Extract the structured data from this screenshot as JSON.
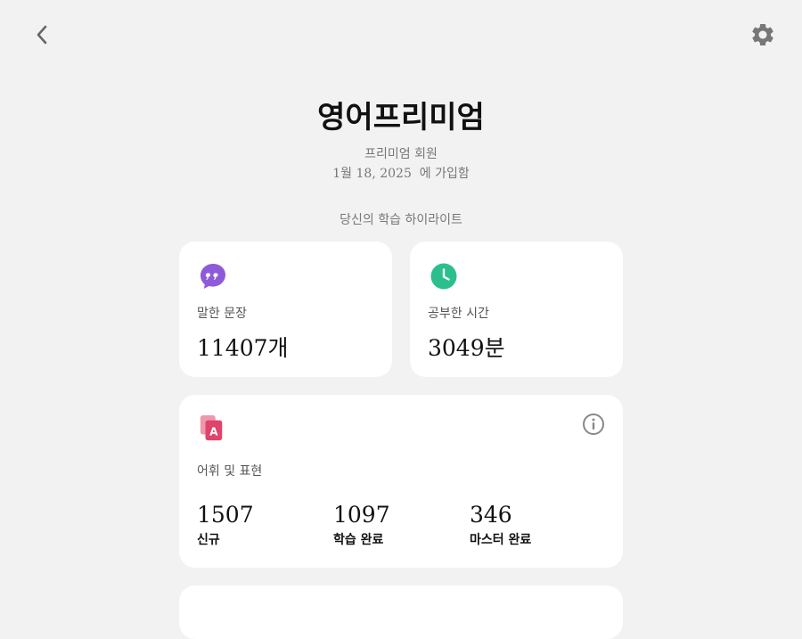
{
  "header": {
    "title": "영어프리미엄",
    "membership": "프리미엄 회원",
    "joined": "1월 18, 2025  에 가입함"
  },
  "highlights": {
    "label": "당신의 학습 하이라이트"
  },
  "stats": {
    "sentences": {
      "label": "말한 문장",
      "value": "11407개",
      "icon": "speech-bubble-quote-icon",
      "color": "#8e5bd8"
    },
    "time": {
      "label": "공부한 시간",
      "value": "3049분",
      "icon": "clock-icon",
      "color": "#2cbf8e"
    }
  },
  "vocab": {
    "label": "어휘 및 표현",
    "icon": "vocab-cards-icon",
    "color": "#e0446a",
    "items": [
      {
        "value": "1507",
        "label": "신규"
      },
      {
        "value": "1097",
        "label": "학습 완료"
      },
      {
        "value": "346",
        "label": "마스터 완료"
      }
    ]
  },
  "icons": {
    "back": "chevron-left-icon",
    "settings": "gear-icon",
    "info": "info-icon"
  }
}
